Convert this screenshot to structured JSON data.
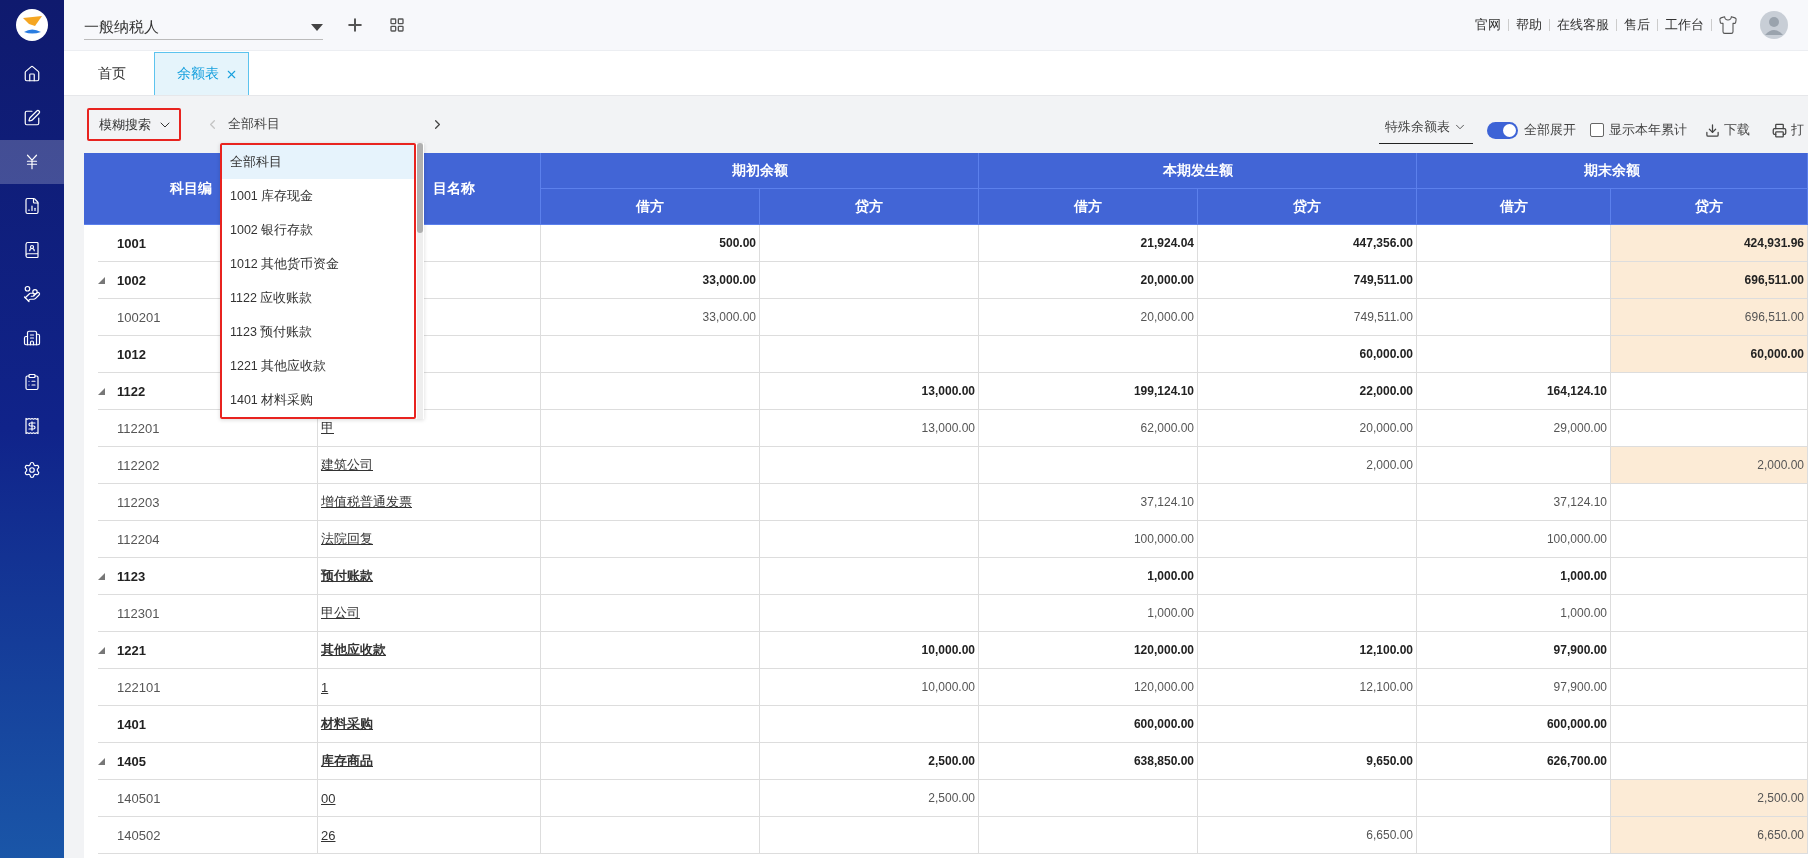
{
  "top_bar": {
    "taxpayer_select": {
      "value": "一般纳税人"
    },
    "links": [
      "官网",
      "帮助",
      "在线客服",
      "售后",
      "工作台"
    ]
  },
  "sidebar": {
    "items": [
      {
        "selected": false
      },
      {
        "selected": false
      },
      {
        "selected": true
      },
      {
        "selected": false
      },
      {
        "selected": false
      },
      {
        "selected": false
      },
      {
        "selected": false
      },
      {
        "selected": false
      },
      {
        "selected": false
      },
      {
        "selected": false
      }
    ]
  },
  "tabs": [
    {
      "label": "首页",
      "selected": false,
      "closable": false
    },
    {
      "label": "余额表",
      "selected": true,
      "closable": true
    }
  ],
  "toolbar": {
    "search_mode": {
      "value": "模糊搜索",
      "annotated": true
    },
    "subject_picker": {
      "value": "全部科目",
      "prev_disabled": true,
      "next_disabled": false,
      "dropdown": {
        "expanded": true,
        "annotated": true,
        "options": [
          {
            "label": "全部科目",
            "selected": true
          },
          {
            "label": "1001 库存现金",
            "selected": false
          },
          {
            "label": "1002 银行存款",
            "selected": false
          },
          {
            "label": "1012 其他货币资金",
            "selected": false
          },
          {
            "label": "1122 应收账款",
            "selected": false
          },
          {
            "label": "1123 预付账款",
            "selected": false
          },
          {
            "label": "1221 其他应收款",
            "selected": false
          },
          {
            "label": "1401 材料采购",
            "selected": false
          }
        ]
      }
    },
    "report_type": {
      "value": "特殊余额表"
    },
    "expand_all": {
      "label": "全部展开",
      "on": true
    },
    "show_ytd": {
      "label": "显示本年累计",
      "checked": false
    },
    "download": {
      "label": "下载"
    },
    "print": {
      "label": "打"
    }
  },
  "table": {
    "code_header": "科目编",
    "name_header": "目名称",
    "groups": [
      {
        "label": "期初余额",
        "sub": [
          "借方",
          "贷方"
        ]
      },
      {
        "label": "本期发生额",
        "sub": [
          "借方",
          "贷方"
        ]
      },
      {
        "label": "期末余额",
        "sub": [
          "借方",
          "贷方"
        ]
      }
    ],
    "rows": [
      {
        "code": "1001",
        "bold": true,
        "highlight": true,
        "values": {
          "opening_debit": "500.00",
          "period_debit": "21,924.04",
          "period_credit": "447,356.00",
          "closing_credit": "424,931.96"
        }
      },
      {
        "code": "1002",
        "bold": true,
        "expanded": true,
        "highlight": true,
        "values": {
          "opening_debit": "33,000.00",
          "period_debit": "20,000.00",
          "period_credit": "749,511.00",
          "closing_credit": "696,511.00"
        }
      },
      {
        "code": "100201",
        "bold": false,
        "highlight": true,
        "values": {
          "opening_debit": "33,000.00",
          "period_debit": "20,000.00",
          "period_credit": "749,511.00",
          "closing_credit": "696,511.00"
        }
      },
      {
        "code": "1012",
        "bold": true,
        "highlight": true,
        "values": {
          "period_credit": "60,000.00",
          "closing_credit": "60,000.00"
        }
      },
      {
        "code": "1122",
        "bold": true,
        "expanded": true,
        "highlight": false,
        "values": {
          "opening_credit": "13,000.00",
          "period_debit": "199,124.10",
          "period_credit": "22,000.00",
          "closing_debit": "164,124.10"
        }
      },
      {
        "code": "112201",
        "name": "甲",
        "bold": false,
        "highlight": false,
        "values": {
          "opening_credit": "13,000.00",
          "period_debit": "62,000.00",
          "period_credit": "20,000.00",
          "closing_debit": "29,000.00"
        }
      },
      {
        "code": "112202",
        "name": "建筑公司",
        "bold": false,
        "highlight": true,
        "values": {
          "period_credit": "2,000.00",
          "closing_credit": "2,000.00"
        }
      },
      {
        "code": "112203",
        "name": "增值税普通发票",
        "bold": false,
        "highlight": false,
        "values": {
          "period_debit": "37,124.10",
          "closing_debit": "37,124.10"
        }
      },
      {
        "code": "112204",
        "name": "法院回复",
        "bold": false,
        "highlight": false,
        "values": {
          "period_debit": "100,000.00",
          "closing_debit": "100,000.00"
        }
      },
      {
        "code": "1123",
        "name": "预付账款",
        "bold": true,
        "expanded": true,
        "highlight": false,
        "values": {
          "period_debit": "1,000.00",
          "closing_debit": "1,000.00"
        }
      },
      {
        "code": "112301",
        "name": "甲公司",
        "bold": false,
        "highlight": false,
        "values": {
          "period_debit": "1,000.00",
          "closing_debit": "1,000.00"
        }
      },
      {
        "code": "1221",
        "name": "其他应收款",
        "bold": true,
        "expanded": true,
        "highlight": false,
        "values": {
          "opening_credit": "10,000.00",
          "period_debit": "120,000.00",
          "period_credit": "12,100.00",
          "closing_debit": "97,900.00"
        }
      },
      {
        "code": "122101",
        "name": "1",
        "bold": false,
        "highlight": false,
        "values": {
          "opening_credit": "10,000.00",
          "period_debit": "120,000.00",
          "period_credit": "12,100.00",
          "closing_debit": "97,900.00"
        }
      },
      {
        "code": "1401",
        "name": "材料采购",
        "bold": true,
        "highlight": false,
        "values": {
          "period_debit": "600,000.00",
          "closing_debit": "600,000.00"
        }
      },
      {
        "code": "1405",
        "name": "库存商品",
        "bold": true,
        "expanded": true,
        "highlight": false,
        "values": {
          "opening_credit": "2,500.00",
          "period_debit": "638,850.00",
          "period_credit": "9,650.00",
          "closing_debit": "626,700.00"
        }
      },
      {
        "code": "140501",
        "name": "00",
        "bold": false,
        "highlight": true,
        "values": {
          "opening_credit": "2,500.00",
          "closing_credit": "2,500.00"
        }
      },
      {
        "code": "140502",
        "name": "26",
        "bold": false,
        "highlight": true,
        "values": {
          "period_credit": "6,650.00",
          "closing_credit": "6,650.00"
        }
      }
    ]
  }
}
